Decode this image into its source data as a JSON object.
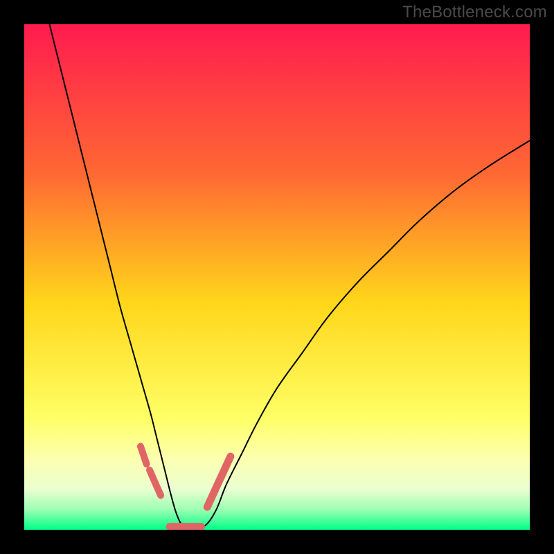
{
  "watermark": "TheBottleneck.com",
  "chart_data": {
    "type": "line",
    "title": "",
    "xlabel": "",
    "ylabel": "",
    "xlim": [
      0,
      100
    ],
    "ylim": [
      0,
      100
    ],
    "grid": false,
    "legend": false,
    "background_gradient": {
      "stops": [
        {
          "offset": 0.0,
          "color": "#ff1b4e"
        },
        {
          "offset": 0.3,
          "color": "#ff6a33"
        },
        {
          "offset": 0.55,
          "color": "#ffd61a"
        },
        {
          "offset": 0.78,
          "color": "#ffff66"
        },
        {
          "offset": 0.86,
          "color": "#fcffb0"
        },
        {
          "offset": 0.92,
          "color": "#eaffd0"
        },
        {
          "offset": 0.96,
          "color": "#9cffb3"
        },
        {
          "offset": 1.0,
          "color": "#00ff88"
        }
      ]
    },
    "series": [
      {
        "name": "bottleneck-curve",
        "color": "#000000",
        "width": 2,
        "x": [
          5,
          7,
          9,
          11,
          13,
          15,
          17,
          19,
          21,
          23,
          25,
          26,
          27,
          28,
          29,
          30,
          31,
          32,
          34,
          36,
          38,
          40,
          43,
          46,
          50,
          55,
          60,
          66,
          72,
          78,
          85,
          92,
          100
        ],
        "y": [
          100,
          92,
          84,
          76,
          68,
          60,
          52,
          44,
          37,
          30,
          23,
          19,
          15,
          11,
          7,
          3.5,
          1.2,
          0.2,
          0.2,
          1.0,
          4,
          9,
          15,
          21,
          28,
          35,
          42,
          49,
          55,
          61,
          67,
          72,
          77
        ]
      }
    ],
    "segments": [
      {
        "name": "left-bump-1",
        "color": "#e06666",
        "width": 10,
        "x": [
          23.0,
          24.2
        ],
        "y": [
          16.5,
          13.0
        ]
      },
      {
        "name": "left-bump-2",
        "color": "#e06666",
        "width": 10,
        "x": [
          24.8,
          27.0
        ],
        "y": [
          11.8,
          6.8
        ]
      },
      {
        "name": "floor-bump",
        "color": "#e06666",
        "width": 11,
        "x": [
          28.8,
          35.0
        ],
        "y": [
          0.6,
          0.6
        ]
      },
      {
        "name": "right-bump",
        "color": "#e06666",
        "width": 11,
        "x": [
          36.2,
          40.8
        ],
        "y": [
          4.5,
          14.5
        ]
      }
    ]
  }
}
